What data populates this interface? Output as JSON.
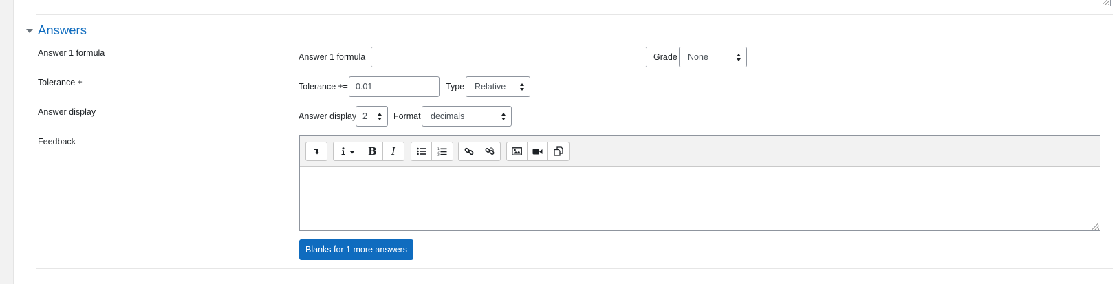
{
  "section": {
    "title": "Answers"
  },
  "rows": {
    "answer_formula": {
      "label": "Answer 1 formula =",
      "inline_label": "Answer 1 formula =",
      "value": "",
      "grade_label": "Grade",
      "grade_value": "None"
    },
    "tolerance": {
      "label": "Tolerance ±",
      "inline_label": "Tolerance ±=",
      "value": "0.01",
      "type_label": "Type",
      "type_value": "Relative"
    },
    "answer_display": {
      "label": "Answer display",
      "inline_label": "Answer display",
      "value": "2",
      "format_label": "Format",
      "format_value": "decimals"
    },
    "feedback": {
      "label": "Feedback",
      "content": ""
    }
  },
  "toolbar": {
    "groups": [
      [
        "collapse-icon"
      ],
      [
        "paragraph-styles-icon",
        "bold-icon",
        "italic-icon"
      ],
      [
        "unordered-list-icon",
        "ordered-list-icon"
      ],
      [
        "link-icon",
        "unlink-icon"
      ],
      [
        "image-icon",
        "media-icon",
        "manage-files-icon"
      ]
    ],
    "bold_glyph": "B",
    "italic_glyph": "I"
  },
  "blanks_button": {
    "label": "Blanks for 1 more answers"
  },
  "colors": {
    "accent": "#0f6cbf",
    "border": "#8f959e",
    "background": "#f2f2f2"
  }
}
